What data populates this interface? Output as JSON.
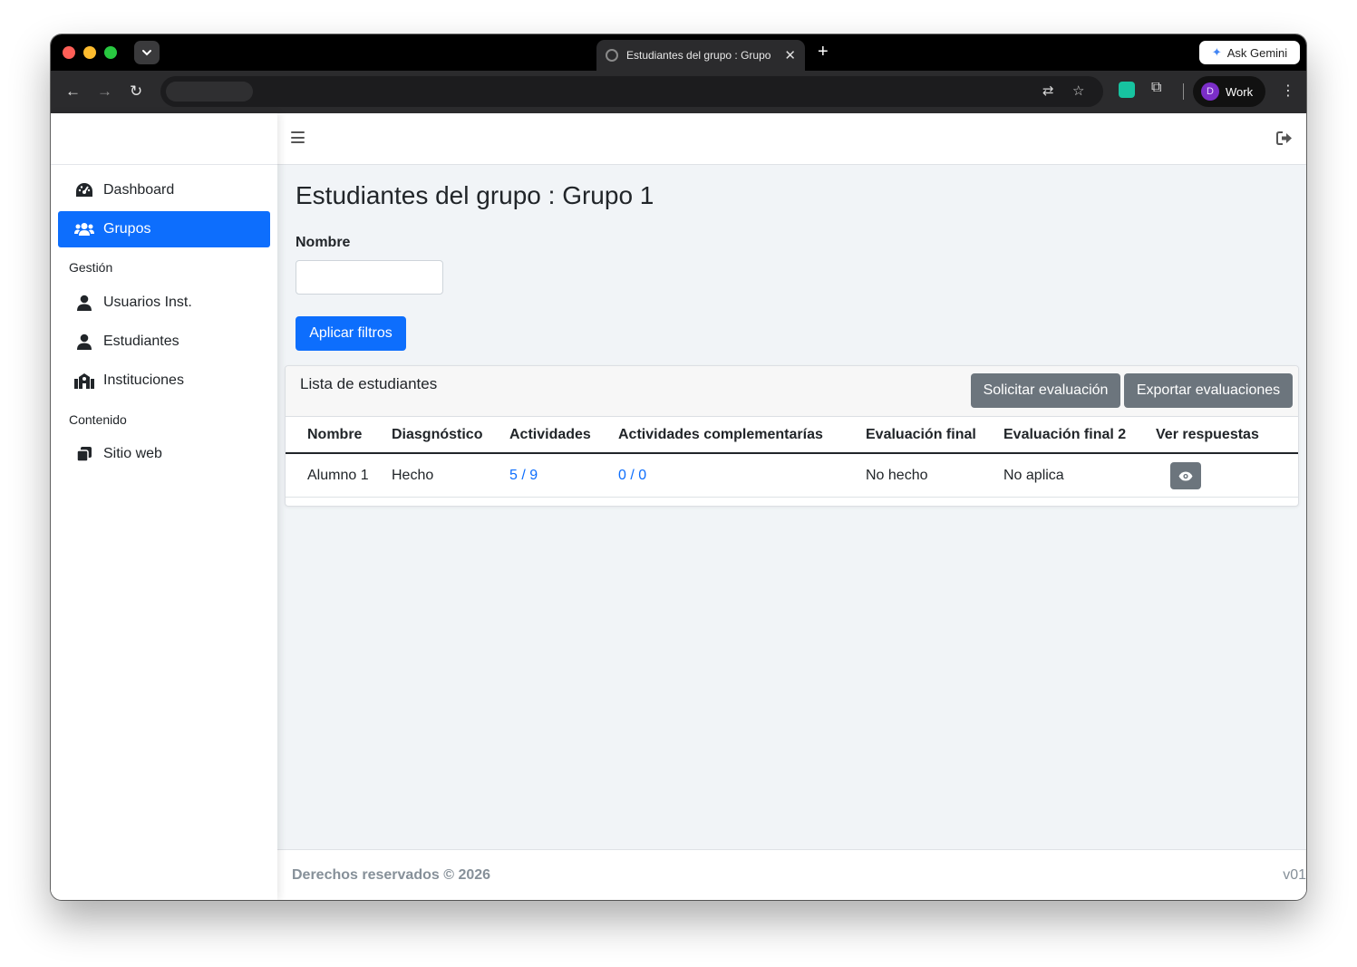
{
  "browser": {
    "tab_title": "Estudiantes del grupo : Grupo",
    "new_tab_symbol": "+",
    "close_symbol": "✕",
    "gemini_label": "Ask Gemini",
    "profile_initial": "D",
    "profile_label": "Work",
    "colors": {
      "chrome": "#000000",
      "toolbar": "#2b2b2d",
      "profile_avatar": "#7b2ec8"
    }
  },
  "sidebar": {
    "items": [
      {
        "label": "Dashboard",
        "icon": "gauge-icon",
        "active": false
      },
      {
        "label": "Grupos",
        "icon": "users-icon",
        "active": true
      }
    ],
    "sections": [
      {
        "heading": "Gestión",
        "items": [
          {
            "label": "Usuarios Inst.",
            "icon": "user-icon"
          },
          {
            "label": "Estudiantes",
            "icon": "user-icon"
          },
          {
            "label": "Instituciones",
            "icon": "school-icon"
          }
        ]
      },
      {
        "heading": "Contenido",
        "items": [
          {
            "label": "Sitio web",
            "icon": "copy-icon"
          }
        ]
      }
    ]
  },
  "main": {
    "title": "Estudiantes del grupo : Grupo 1",
    "filters": {
      "name_label": "Nombre",
      "name_value": "",
      "apply_label": "Aplicar filtros"
    },
    "card": {
      "title": "Lista de estudiantes",
      "request_eval_label": "Solicitar evaluación",
      "export_eval_label": "Exportar evaluaciones",
      "columns": [
        "Nombre",
        "Diasgnóstico",
        "Actividades",
        "Actividades complementarías",
        "Evaluación final",
        "Evaluación final 2",
        "Ver respuestas"
      ],
      "rows": [
        {
          "name": "Alumno 1",
          "diagnostic": "Hecho",
          "activities": "5 / 9",
          "complementary": "0 / 0",
          "final_eval": "No hecho",
          "final_eval_2": "No aplica",
          "action_icon": "eye-icon"
        }
      ]
    }
  },
  "footer": {
    "copyright": "Derechos reservados © 2026",
    "version": "v01"
  },
  "colors": {
    "primary": "#0d6efd",
    "secondary": "#6c757d",
    "page_bg": "#f1f4f7",
    "muted": "#869099"
  }
}
